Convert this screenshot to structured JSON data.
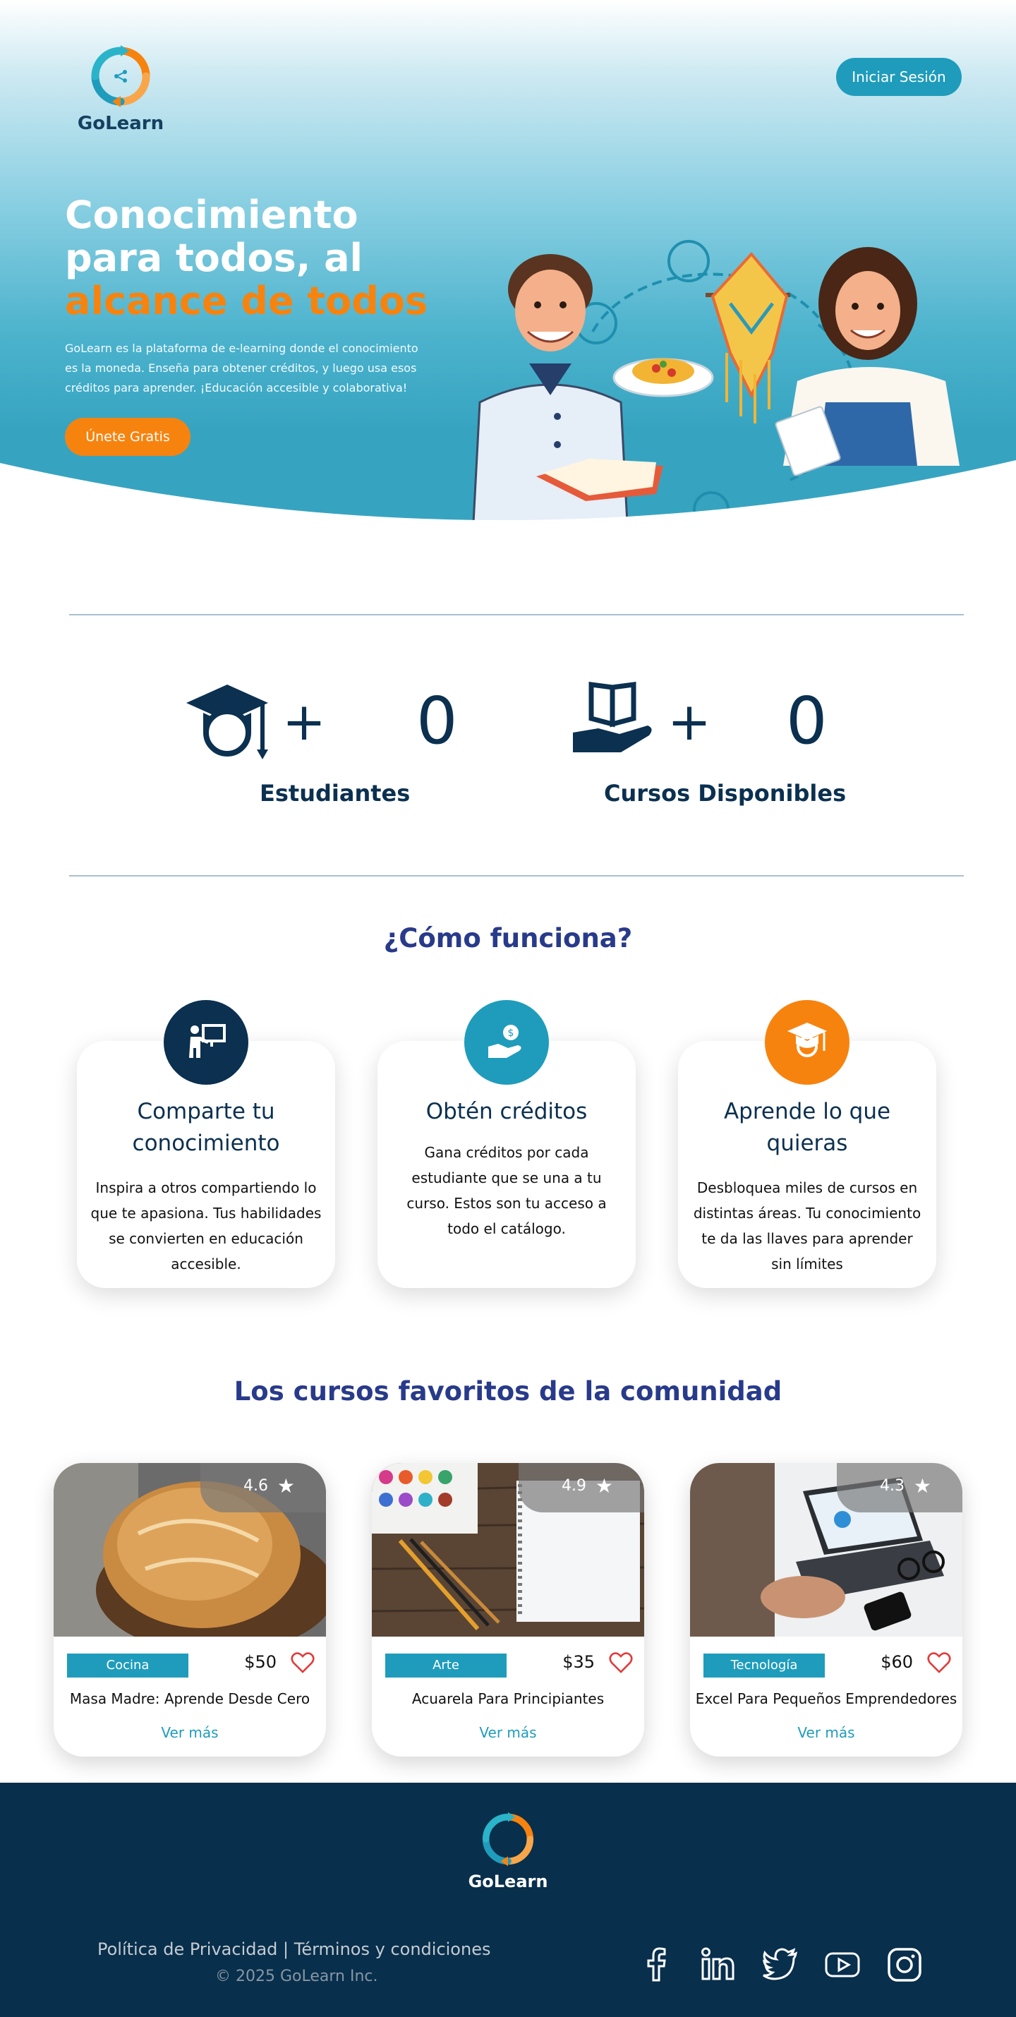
{
  "brand": {
    "name": "GoLearn"
  },
  "header": {
    "login_label": "Iniciar Sesión"
  },
  "hero": {
    "title_line1": "Conocimiento",
    "title_line2": "para todos, al",
    "title_accent": "alcance de todos",
    "description": "GoLearn es la plataforma de e-learning donde el conocimiento es la moneda. Enseña para obtener créditos, y luego usa esos créditos para aprender. ¡Educación accesible y colaborativa!",
    "cta_label": "Únete Gratis"
  },
  "stats": [
    {
      "icon": "graduate-icon",
      "plus": "+",
      "value": "0",
      "label": "Estudiantes"
    },
    {
      "icon": "book-hand-icon",
      "plus": "+",
      "value": "0",
      "label": "Cursos Disponibles"
    }
  ],
  "how": {
    "title": "¿Cómo funciona?",
    "steps": [
      {
        "icon": "teacher-board-icon",
        "color": "#0b3050",
        "title": "Comparte tu conocimiento",
        "text": "Inspira a otros compartiendo lo que te apasiona. Tus habilidades se convierten en educación accesible."
      },
      {
        "icon": "coin-hand-icon",
        "color": "#1f9cbb",
        "title": "Obtén créditos",
        "text": "Gana créditos por cada estudiante que se una a tu curso. Estos son tu acceso a todo el catálogo."
      },
      {
        "icon": "graduate-icon",
        "color": "#f7830f",
        "title": "Aprende lo que quieras",
        "text": "Desbloquea miles de cursos en distintas áreas. Tu conocimiento te da las llaves para aprender sin límites"
      }
    ]
  },
  "courses": {
    "title": "Los cursos favoritos de la comunidad",
    "items": [
      {
        "rating": "4.6",
        "category": "Cocina",
        "price": "$50",
        "title": "Masa Madre: Aprende Desde Cero",
        "more": "Ver más"
      },
      {
        "rating": "4.9",
        "category": "Arte",
        "price": "$35",
        "title": "Acuarela Para Principiantes",
        "more": "Ver más"
      },
      {
        "rating": "4.3",
        "category": "Tecnología",
        "price": "$60",
        "title": "Excel Para Pequeños Emprendedores",
        "more": "Ver más"
      }
    ]
  },
  "footer": {
    "links": "Política de Privacidad | Términos y condiciones",
    "copyright": "© 2025 GoLearn Inc.",
    "social": [
      "facebook-icon",
      "linkedin-icon",
      "twitter-icon",
      "youtube-icon",
      "instagram-icon"
    ]
  },
  "colors": {
    "accent": "#f7830f",
    "primary": "#1f9cbb",
    "navy": "#0b3050",
    "heading": "#283a8a"
  }
}
